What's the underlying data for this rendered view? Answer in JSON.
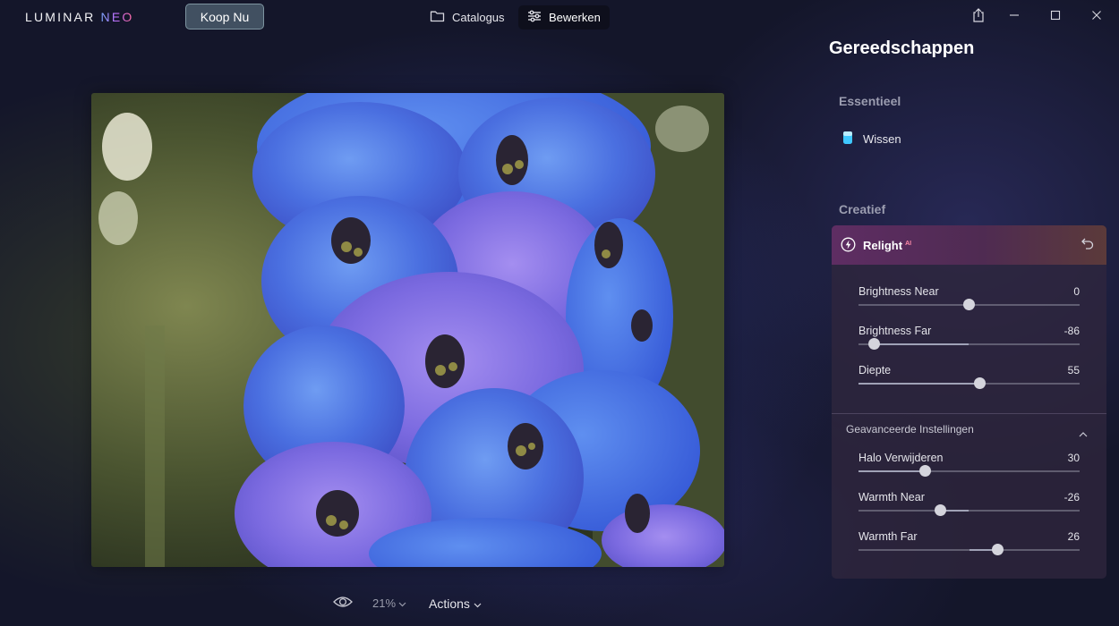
{
  "app": {
    "logo_text": "LUMINAR",
    "logo_accent": "NEO",
    "buy_label": "Koop Nu"
  },
  "nav": {
    "tabs": [
      {
        "label": "Catalogus",
        "icon": "folder-icon",
        "active": false
      },
      {
        "label": "Bewerken",
        "icon": "sliders-icon",
        "active": true
      }
    ]
  },
  "window_controls": [
    "share-icon",
    "minimize-icon",
    "maximize-icon",
    "close-icon"
  ],
  "bottom_toolbar": {
    "zoom_label": "21%",
    "actions_label": "Actions"
  },
  "panel": {
    "title": "Gereedschappen",
    "essentials": {
      "heading": "Essentieel",
      "items": [
        {
          "label": "Wissen",
          "icon": "eraser-icon"
        }
      ]
    },
    "creative": {
      "heading": "Creatief",
      "tool": {
        "name": "Relight",
        "badge": "AI",
        "sliders": [
          {
            "label": "Brightness Near",
            "value": "0",
            "min": -100,
            "max": 100,
            "number": 0
          },
          {
            "label": "Brightness Far",
            "value": "-86",
            "min": -100,
            "max": 100,
            "number": -86
          },
          {
            "label": "Diepte",
            "value": "55",
            "min": 0,
            "max": 100,
            "number": 55
          }
        ],
        "advanced": {
          "heading": "Geavanceerde Instellingen",
          "expanded": true,
          "sliders": [
            {
              "label": "Halo Verwijderen",
              "value": "30",
              "min": 0,
              "max": 100,
              "number": 30
            },
            {
              "label": "Warmth Near",
              "value": "-26",
              "min": -100,
              "max": 100,
              "number": -26
            },
            {
              "label": "Warmth Far",
              "value": "26",
              "min": -100,
              "max": 100,
              "number": 26
            }
          ]
        }
      }
    }
  },
  "colors": {
    "accent_cyan": "#3fc8ff",
    "relight_header": "#5e2d63",
    "background": "#14162a"
  }
}
